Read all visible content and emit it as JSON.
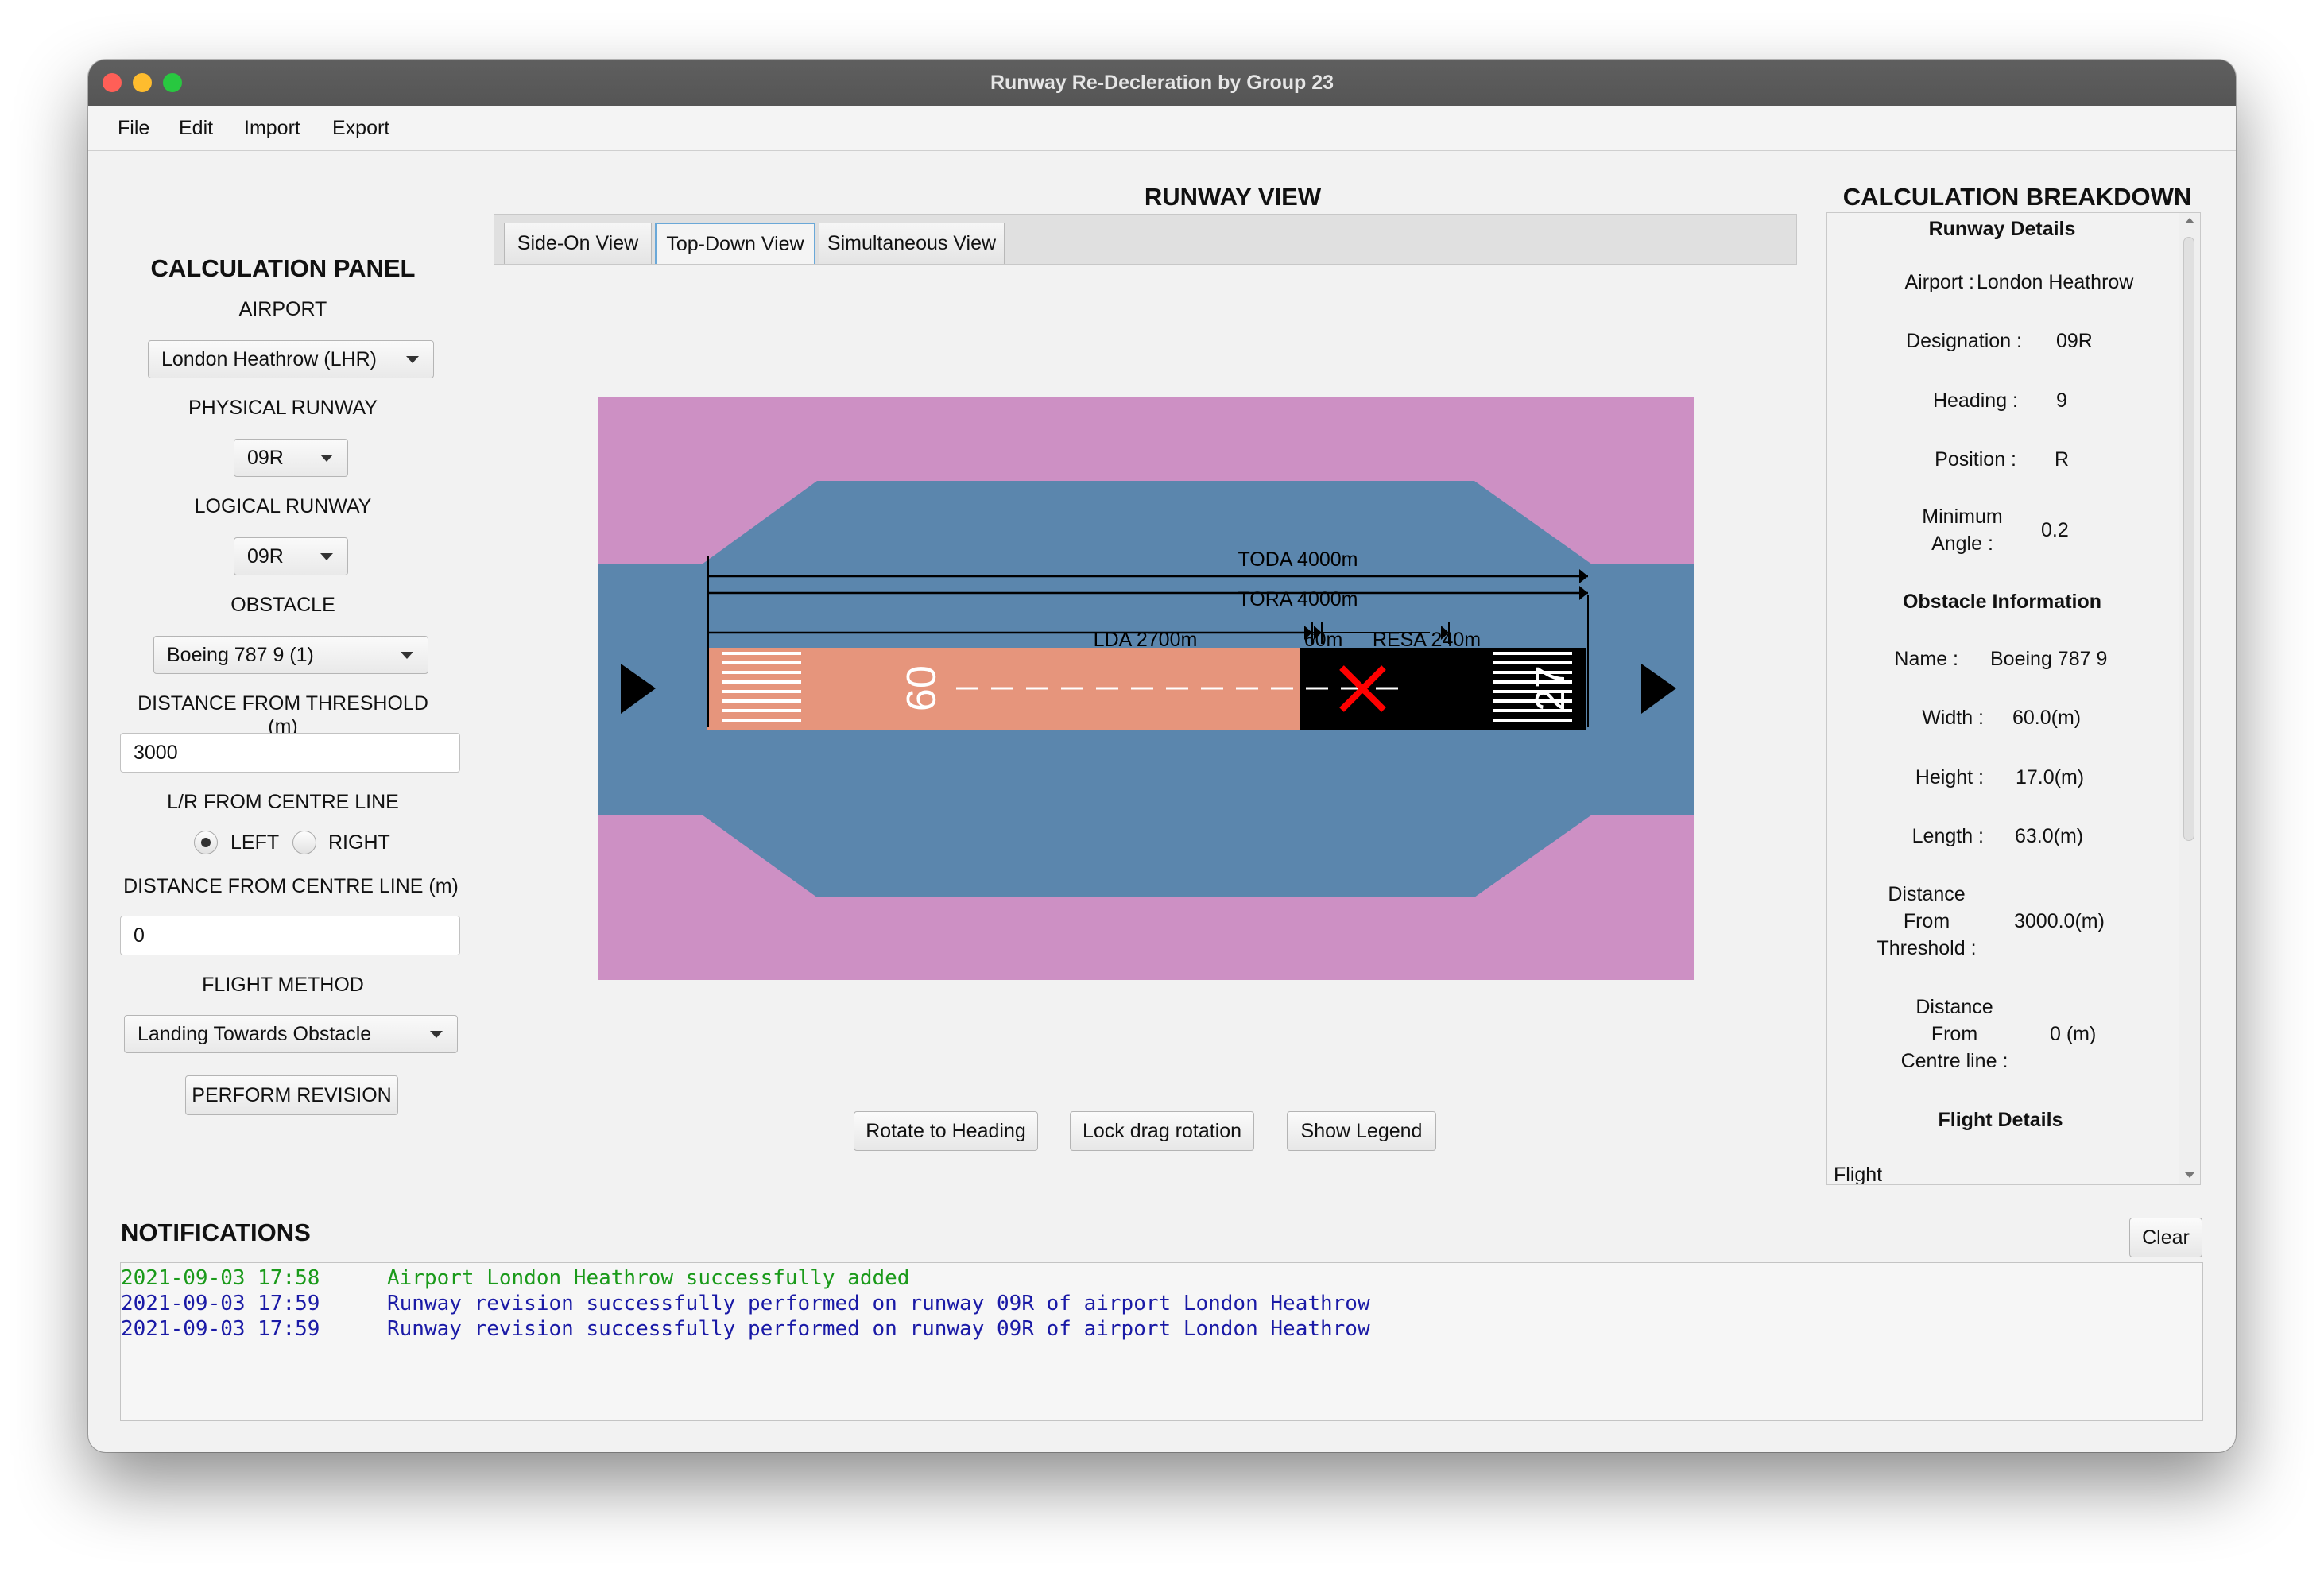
{
  "window": {
    "title": "Runway Re-Decleration by Group 23"
  },
  "menu": [
    "File",
    "Edit",
    "Import",
    "Export"
  ],
  "calc_panel": {
    "title": "CALCULATION PANEL",
    "airport_label": "AIRPORT",
    "airport_value": "London Heathrow (LHR)",
    "physical_label": "PHYSICAL RUNWAY",
    "physical_value": "09R",
    "logical_label": "LOGICAL RUNWAY",
    "logical_value": "09R",
    "obstacle_label": "OBSTACLE",
    "obstacle_value": "Boeing 787 9 (1)",
    "dist_threshold_label": "DISTANCE FROM THRESHOLD (m)",
    "dist_threshold_value": "3000",
    "lr_label": "L/R FROM CENTRE LINE",
    "left_label": "LEFT",
    "right_label": "RIGHT",
    "selected_side": "LEFT",
    "dist_centre_label": "DISTANCE FROM CENTRE LINE (m)",
    "dist_centre_value": "0",
    "flight_method_label": "FLIGHT METHOD",
    "flight_method_value": "Landing Towards Obstacle",
    "perform_button": "PERFORM REVISION"
  },
  "runway_view": {
    "title": "RUNWAY VIEW",
    "tabs": [
      "Side-On View",
      "Top-Down View",
      "Simultaneous View"
    ],
    "active_tab": "Top-Down View",
    "labels": {
      "toda": "TODA 4000m",
      "tora": "TORA 4000m",
      "lda": "LDA 2700m",
      "sixty": "60m",
      "resa": "RESA 240m",
      "designator_left": "09",
      "designator_right": "27"
    },
    "colors": {
      "grass": "#cd90c4",
      "clearway": "#5b86ad",
      "runway_usable": "#e6957c",
      "runway_blocked": "#000000",
      "obstacle_mark": "#ff0000"
    },
    "buttons": [
      "Rotate to Heading",
      "Lock drag rotation",
      "Show Legend"
    ]
  },
  "breakdown": {
    "title": "CALCULATION BREAKDOWN",
    "runway_details_heading": "Runway Details",
    "airport_label": "Airport :",
    "airport_value": "London Heathrow",
    "designation_label": "Designation :",
    "designation_value": "09R",
    "heading_label": "Heading :",
    "heading_value": "9",
    "position_label": "Position :",
    "position_value": "R",
    "min_angle_label_1": "Minimum",
    "min_angle_label_2": "Angle :",
    "min_angle_value": "0.2",
    "obstacle_heading": "Obstacle Information",
    "name_label": "Name :",
    "name_value": "Boeing 787 9",
    "width_label": "Width :",
    "width_value": "60.0(m)",
    "height_label": "Height :",
    "height_value": "17.0(m)",
    "length_label": "Length :",
    "length_value": "63.0(m)",
    "dft_label_1": "Distance",
    "dft_label_2": "From",
    "dft_label_3": "Threshold :",
    "dft_value": "3000.0(m)",
    "dfc_label_1": "Distance",
    "dfc_label_2": "From",
    "dfc_label_3": "Centre line :",
    "dfc_value": "0 (m)",
    "flight_heading": "Flight Details",
    "flight_label_partial": "Flight"
  },
  "notifications": {
    "title": "NOTIFICATIONS",
    "clear_button": "Clear",
    "entries": [
      {
        "time": "2021-09-03 17:58",
        "message": "Airport London Heathrow successfully added",
        "color": "#1a9a1a"
      },
      {
        "time": "2021-09-03 17:59",
        "message": "Runway revision successfully performed on runway 09R of airport London Heathrow",
        "color": "#1a1aa6"
      },
      {
        "time": "2021-09-03 17:59",
        "message": "Runway revision successfully performed on runway 09R of airport London Heathrow",
        "color": "#1a1aa6"
      }
    ]
  }
}
